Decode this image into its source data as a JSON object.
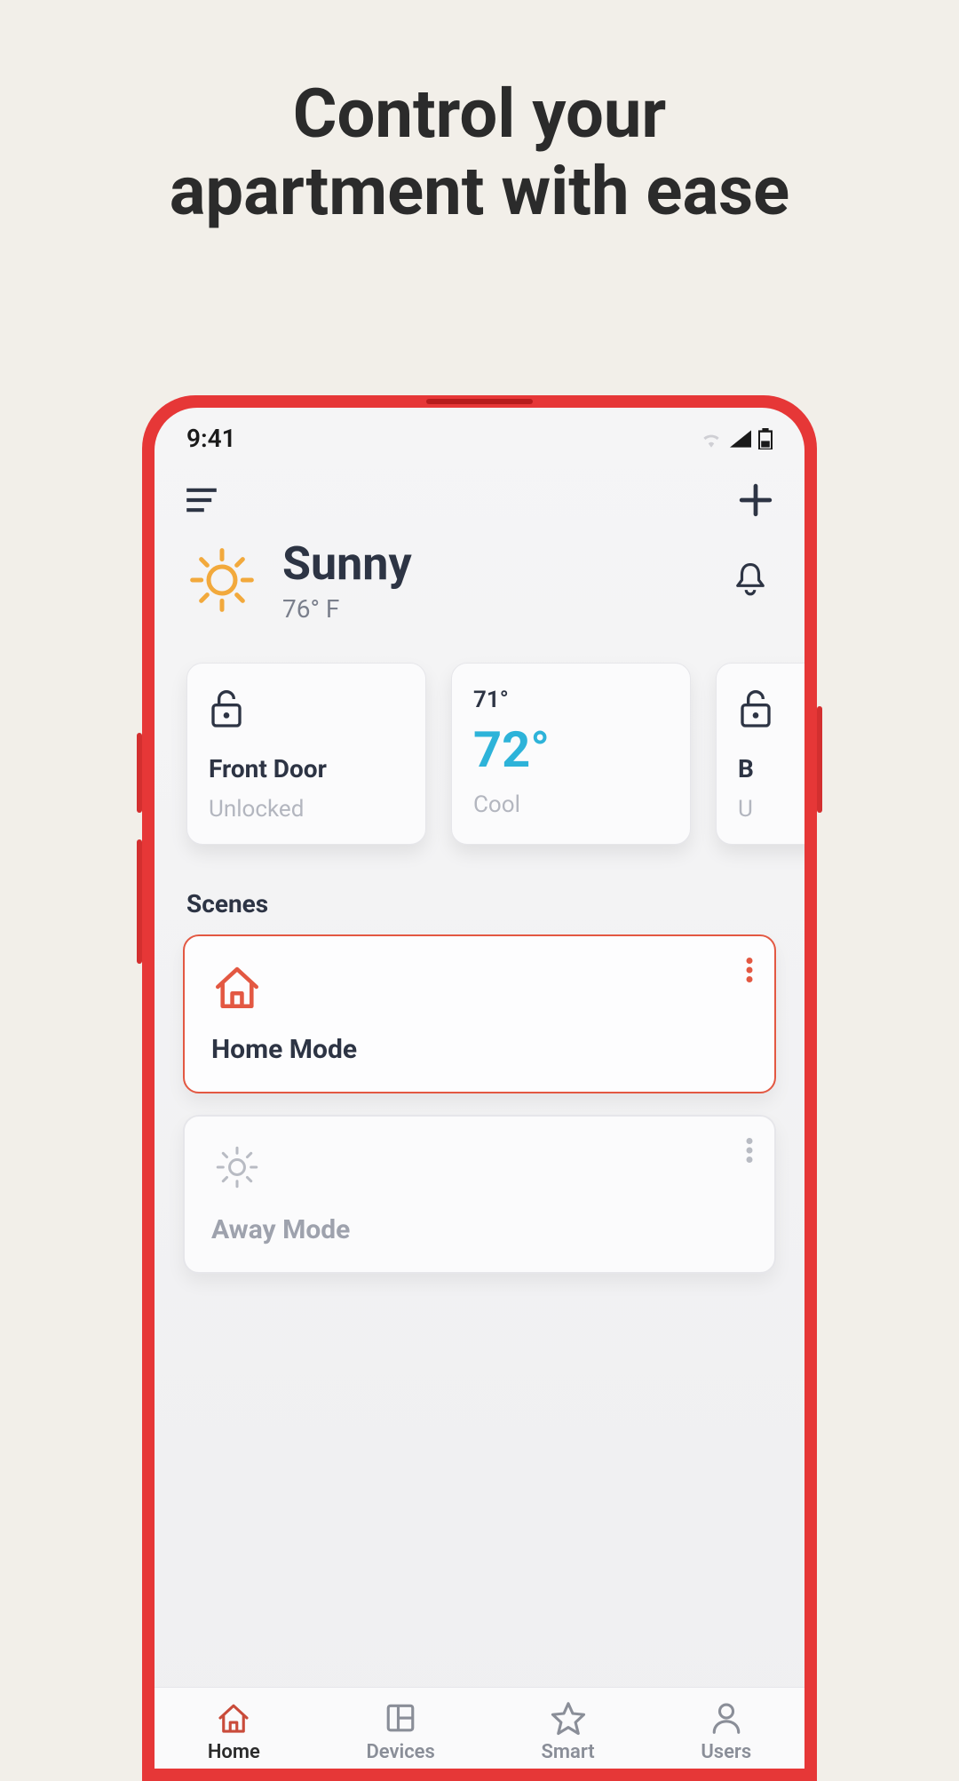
{
  "headline_line1": "Control your",
  "headline_line2": "apartment with ease",
  "status": {
    "time": "9:41"
  },
  "weather": {
    "condition": "Sunny",
    "temp": "76° F"
  },
  "cards": [
    {
      "title": "Front Door",
      "sub": "Unlocked"
    },
    {
      "top": "71°",
      "main": "72°",
      "sub": "Cool"
    },
    {
      "title": "B",
      "sub": "U"
    }
  ],
  "scenes_label": "Scenes",
  "scenes": [
    {
      "name": "Home Mode"
    },
    {
      "name": "Away Mode"
    }
  ],
  "nav": {
    "home": "Home",
    "devices": "Devices",
    "smart": "Smart",
    "users": "Users"
  }
}
